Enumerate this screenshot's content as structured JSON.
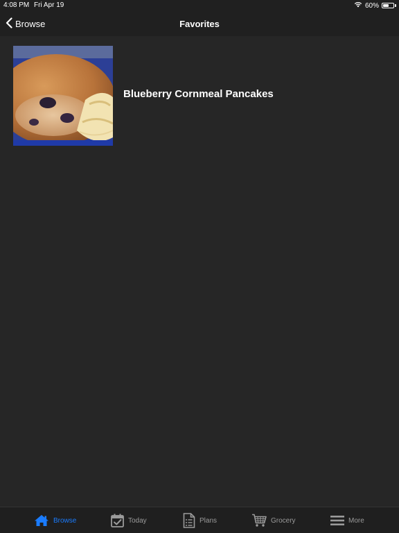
{
  "status_bar": {
    "time": "4:08 PM",
    "date": "Fri Apr 19",
    "battery_text": "60%",
    "battery_level": 0.6
  },
  "nav": {
    "back_label": "Browse",
    "title": "Favorites"
  },
  "favorites": [
    {
      "title": "Blueberry Cornmeal Pancakes",
      "image_icon": "pancake-photo"
    }
  ],
  "tabs": [
    {
      "label": "Browse",
      "icon": "home-icon",
      "active": true
    },
    {
      "label": "Today",
      "icon": "calendar-check-icon",
      "active": false
    },
    {
      "label": "Plans",
      "icon": "document-list-icon",
      "active": false
    },
    {
      "label": "Grocery",
      "icon": "cart-icon",
      "active": false
    },
    {
      "label": "More",
      "icon": "menu-icon",
      "active": false
    }
  ],
  "colors": {
    "accent": "#1a7cff",
    "inactive": "#9b9b9b",
    "background": "#262626",
    "bar": "#202020"
  }
}
